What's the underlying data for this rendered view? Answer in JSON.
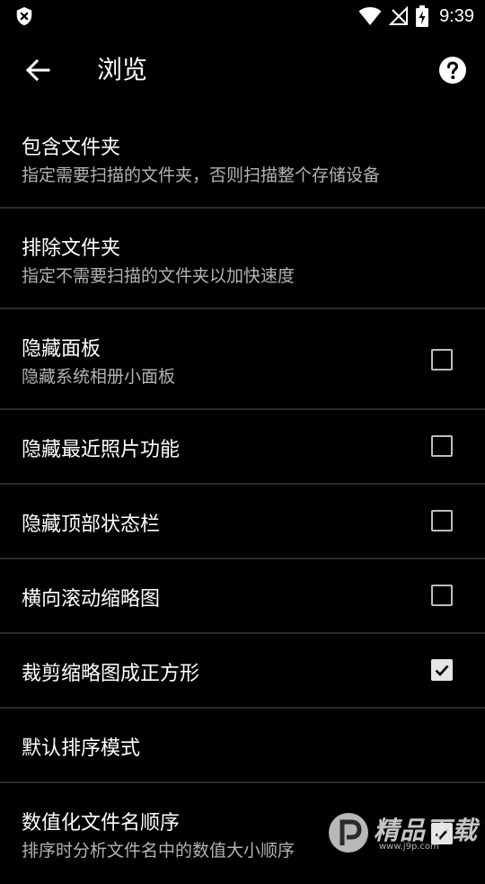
{
  "status_bar": {
    "time": "9:39"
  },
  "toolbar": {
    "title": "浏览"
  },
  "settings": [
    {
      "title": "包含文件夹",
      "subtitle": "指定需要扫描的文件夹，否则扫描整个存储设备"
    },
    {
      "title": "排除文件夹",
      "subtitle": "指定不需要扫描的文件夹以加快速度"
    },
    {
      "title": "隐藏面板",
      "subtitle": "隐藏系统相册小面板",
      "checked": false
    },
    {
      "title": "隐藏最近照片功能",
      "checked": false
    },
    {
      "title": "隐藏顶部状态栏",
      "checked": false
    },
    {
      "title": "横向滚动缩略图",
      "checked": false
    },
    {
      "title": "裁剪缩略图成正方形",
      "checked": true
    },
    {
      "title": "默认排序模式"
    },
    {
      "title": "数值化文件名顺序",
      "subtitle": "排序时分析文件名中的数值大小顺序",
      "checked": true
    }
  ],
  "watermark": {
    "text": "精品下载",
    "url": "www.j9p.com"
  }
}
